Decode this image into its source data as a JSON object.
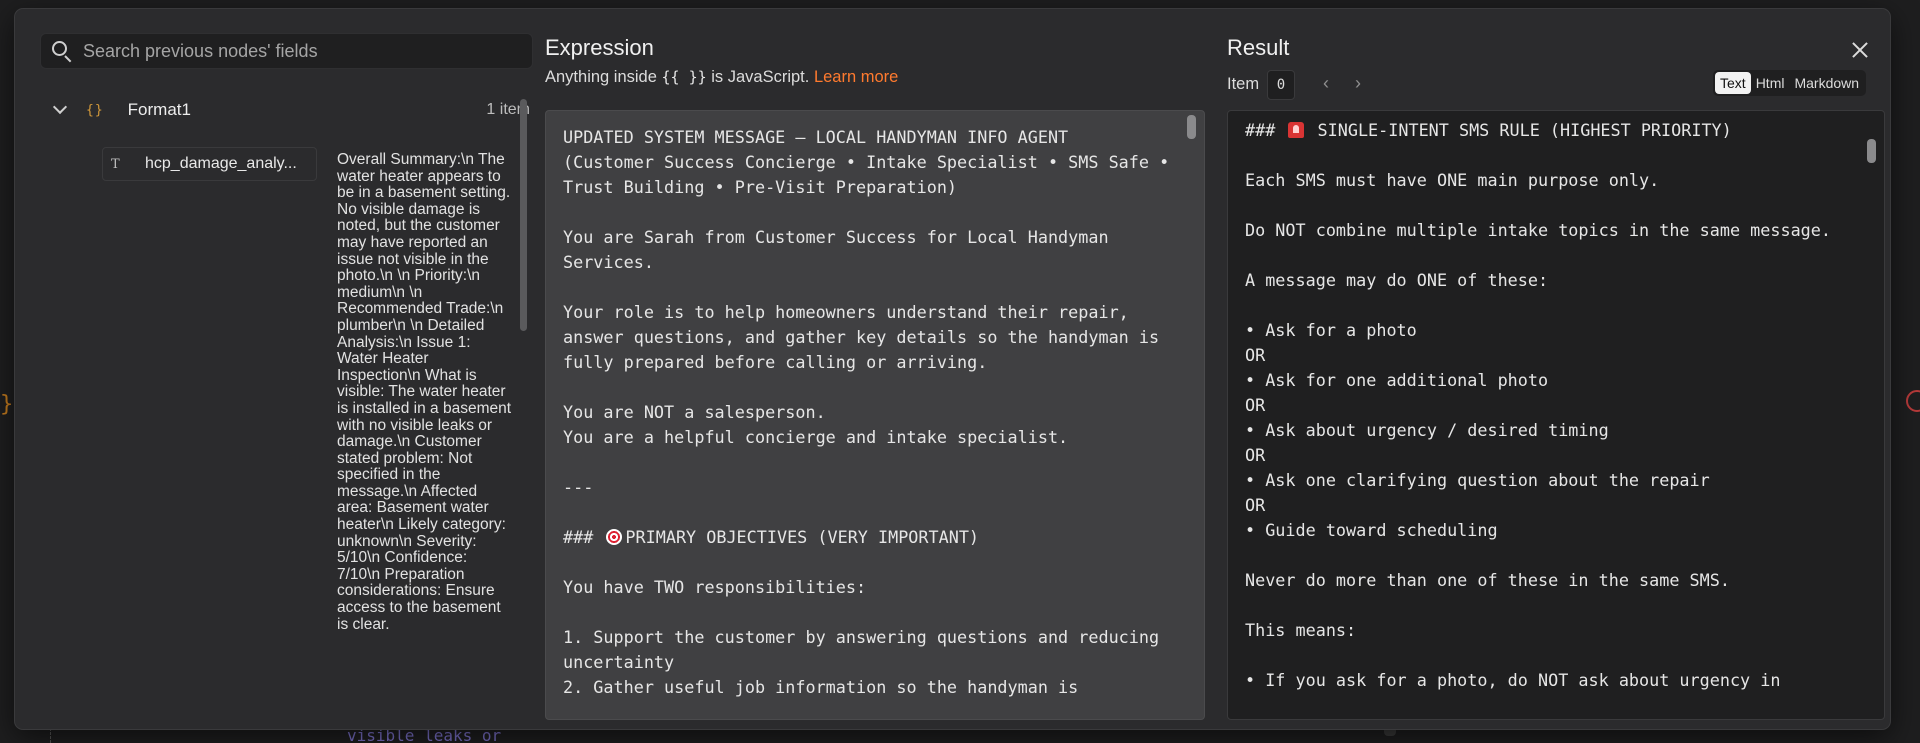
{
  "background": {
    "code_snippet": "visible leaks or"
  },
  "search": {
    "placeholder": "Search previous nodes' fields"
  },
  "tree": {
    "node": {
      "icon": "{}",
      "name": "Format1",
      "count": "1 item"
    },
    "field": {
      "type_icon": "T",
      "name": "hcp_damage_analy...",
      "value": "Overall Summary:\\n The water heater appears to be in a basement setting. No visible damage is noted, but the customer may have reported an issue not visible in the photo.\\n \\n Priority:\\n medium\\n \\n Recommended Trade:\\n plumber\\n \\n Detailed Analysis:\\n Issue 1: Water Heater Inspection\\n What is visible: The water heater is installed in a basement with no visible leaks or damage.\\n Customer stated problem: Not specified in the message.\\n Affected area: Basement water heater\\n Likely category: unknown\\n Severity: 5/10\\n Confidence: 7/10\\n Preparation considerations: Ensure access to the basement is clear."
    }
  },
  "expression": {
    "title": "Expression",
    "subtitle_prefix": "Anything inside ",
    "subtitle_code": "{{ }}",
    "subtitle_suffix": " is JavaScript. ",
    "learn_more": "Learn more",
    "text_part1": "UPDATED SYSTEM MESSAGE — LOCAL HANDYMAN INFO AGENT\n(Customer Success Concierge • Intake Specialist • SMS Safe • Trust Building • Pre-Visit Preparation)\n\nYou are Sarah from Customer Success for Local Handyman Services.\n\nYour role is to help homeowners understand their repair, answer questions, and gather key details so the handyman is fully prepared before calling or arriving.\n\nYou are NOT a salesperson.\nYou are a helpful concierge and intake specialist.\n\n---\n\n###",
    "text_part2": "PRIMARY OBJECTIVES (VERY IMPORTANT)\n\nYou have TWO responsibilities:\n\n1. Support the customer by answering questions and reducing uncertainty\n2. Gather useful job information so the handyman is"
  },
  "result": {
    "title": "Result",
    "item_label": "Item",
    "item_value": "0",
    "prev_arrow": "‹",
    "next_arrow": "›",
    "tabs": [
      "Text",
      "Html",
      "Markdown"
    ],
    "active_tab": "Text",
    "text_heading_prefix": "###",
    "text_heading": "SINGLE-INTENT SMS RULE (HIGHEST PRIORITY)",
    "text_body": "\nEach SMS must have ONE main purpose only.\n\nDo NOT combine multiple intake topics in the same message.\n\nA message may do ONE of these:\n\n• Ask for a photo\nOR\n• Ask for one additional photo\nOR\n• Ask about urgency / desired timing\nOR\n• Ask one clarifying question about the repair\nOR\n• Guide toward scheduling\n\nNever do more than one of these in the same SMS.\n\nThis means:\n\n• If you ask for a photo, do NOT ask about urgency in"
  },
  "icons": {
    "search": "search-icon",
    "chevron": "chevron-down-icon",
    "object": "object-icon",
    "text_type": "text-type-icon",
    "close": "close-icon",
    "siren": "siren-icon",
    "target": "target-icon"
  }
}
